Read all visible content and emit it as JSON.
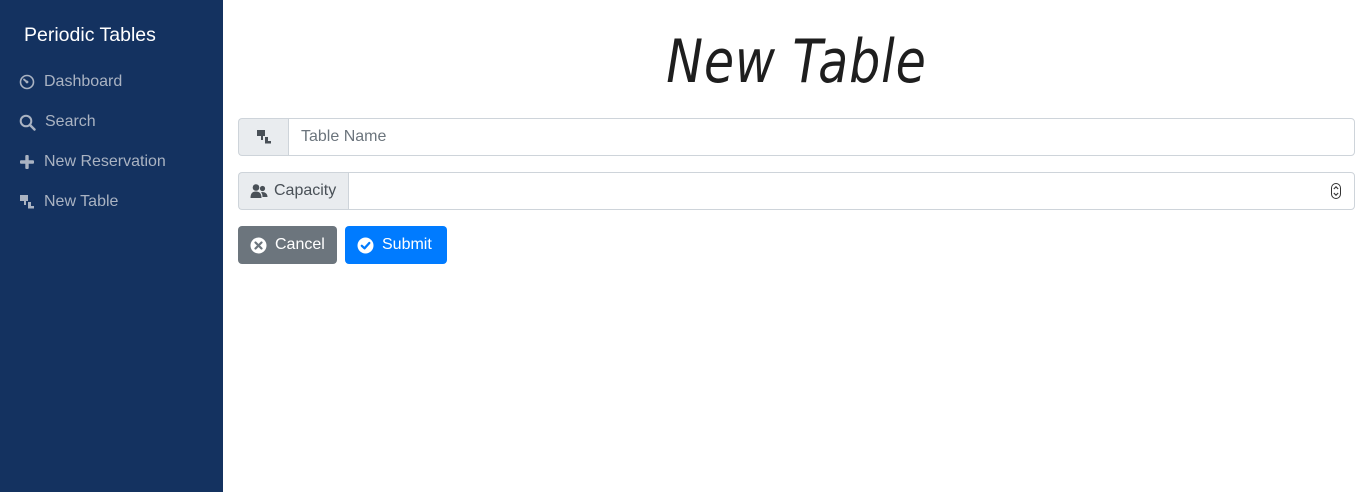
{
  "sidebar": {
    "brand": "Periodic Tables",
    "items": [
      {
        "label": "Dashboard",
        "icon": "dashboard-icon"
      },
      {
        "label": "Search",
        "icon": "search-icon"
      },
      {
        "label": "New Reservation",
        "icon": "plus-icon"
      },
      {
        "label": "New Table",
        "icon": "table-icon"
      }
    ]
  },
  "main": {
    "title": "New Table",
    "table_name": {
      "placeholder": "Table Name",
      "value": "",
      "icon": "table-icon"
    },
    "capacity": {
      "label": "Capacity",
      "value": "",
      "icon": "users-icon"
    },
    "buttons": {
      "cancel_label": "Cancel",
      "submit_label": "Submit"
    }
  },
  "colors": {
    "sidebar_bg": "#143260",
    "primary": "#007bff",
    "secondary": "#6c757d"
  }
}
